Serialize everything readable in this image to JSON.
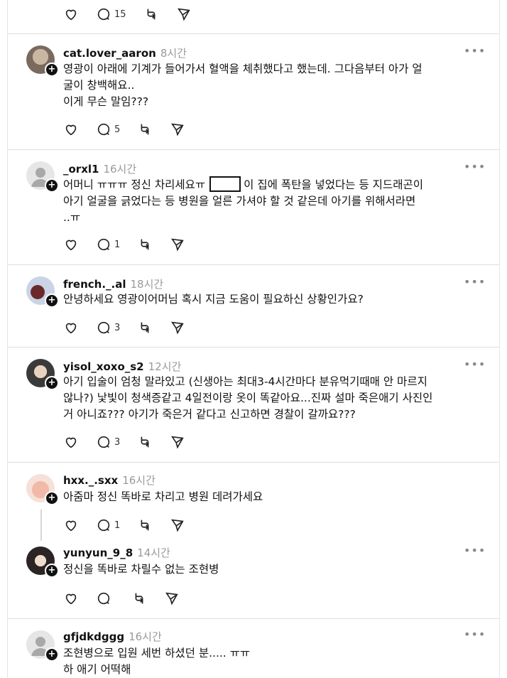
{
  "top_actions": {
    "reply_count": "15"
  },
  "posts": [
    {
      "username": "cat.lover_aaron",
      "time": "8시간",
      "lines": [
        "영광이 아래에 기계가 들어가서 혈액을 체취했다고 했는데. 그다음부터 아가 얼",
        "굴이 창백해요..",
        "이게 무슨 말임???"
      ],
      "reply_count": "5"
    },
    {
      "username": "_orxl1",
      "time": "16시간",
      "line1_before": "어머니 ㅠㅠㅠ 정신 차리세요ㅠ",
      "line1_after": "이 집에 폭탄을 넣었다는 등 지드래곤이",
      "lines": [
        "아기 얼굴을 긁었다는 등 병원을 얼른 가셔야 할 것 같은데 아기를 위해서라면",
        "..ㅠ"
      ],
      "reply_count": "1"
    },
    {
      "username": "french._.al",
      "time": "18시간",
      "lines": [
        "안녕하세요 영광이어머님 혹시 지금 도움이 필요하신 상황인가요?"
      ],
      "reply_count": "3"
    },
    {
      "username": "yisol_xoxo_s2",
      "time": "12시간",
      "lines": [
        "아기 입술이 엄청 말라있고 (신생아는 최대3-4시간마다 분유먹기때매 안 마르지",
        "않나?) 낯빛이 청색증같고 4일전이랑 옷이 똑같아요...진짜 설마 죽은애기 사진인",
        "거 아니죠??? 아기가 죽은거 같다고 신고하면 경찰이 갈까요???"
      ],
      "reply_count": "3"
    },
    {
      "username": "hxx._.sxx",
      "time": "16시간",
      "lines": [
        "아줌마 정신 똑바로 차리고 병원 데려가세요"
      ],
      "reply_count": "1"
    },
    {
      "username": "yunyun_9_8",
      "time": "14시간",
      "lines": [
        "정신을 똑바로 차릴수 없는 조현병"
      ],
      "reply_count": ""
    },
    {
      "username": "gfjdkdggg",
      "time": "16시간",
      "lines": [
        "조현병으로 입원 세번 하셨던 분..... ㅠㅠ",
        "하 애기 어떡해"
      ]
    }
  ],
  "colors": {
    "divider": "#dedede",
    "muted": "#9a9a9a",
    "text": "#111111"
  },
  "icons": {
    "like": "heart-icon",
    "reply": "comment-icon",
    "repost": "repost-icon",
    "share": "send-icon",
    "more": "more-icon",
    "follow": "plus-icon"
  }
}
